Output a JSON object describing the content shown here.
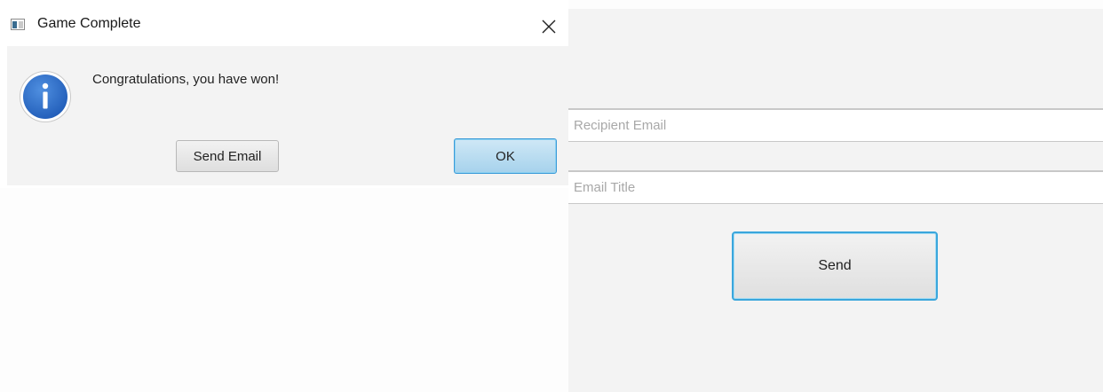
{
  "dialog": {
    "title": "Game Complete",
    "title_icon": "java-app-icon",
    "close_icon": "close-icon",
    "message": "Congratulations, you have won!",
    "message_icon": "info-icon",
    "send_email_label": "Send Email",
    "ok_label": "OK"
  },
  "email_form": {
    "recipient_placeholder": "Recipient Email",
    "recipient_value": "",
    "title_placeholder": "Email Title",
    "title_value": "",
    "send_label": "Send"
  },
  "colors": {
    "dialog_body_bg": "#f3f3f3",
    "info_icon_blue": "#2f6fc9",
    "ok_button": "#a6d2ec",
    "focus_border": "#3aa6dc"
  }
}
